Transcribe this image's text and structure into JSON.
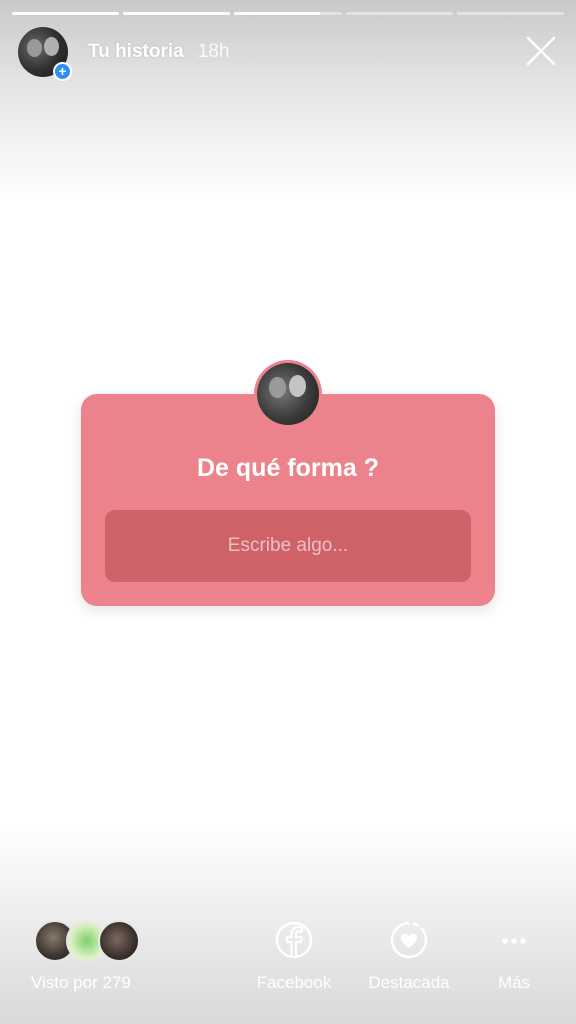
{
  "story": {
    "title": "Tu historia",
    "time": "18h",
    "progress_segments": [
      1,
      1,
      0.8,
      0,
      0
    ]
  },
  "sticker": {
    "question": "De qué forma ?",
    "answer_placeholder": "Escribe algo...",
    "color": "#ec838c",
    "field_color": "#cf6169"
  },
  "footer": {
    "viewed_label": "Visto por 279",
    "actions": [
      {
        "label": "Facebook",
        "icon": "facebook-icon"
      },
      {
        "label": "Destacada",
        "icon": "highlight-heart-icon"
      },
      {
        "label": "Más",
        "icon": "more-icon"
      }
    ]
  }
}
